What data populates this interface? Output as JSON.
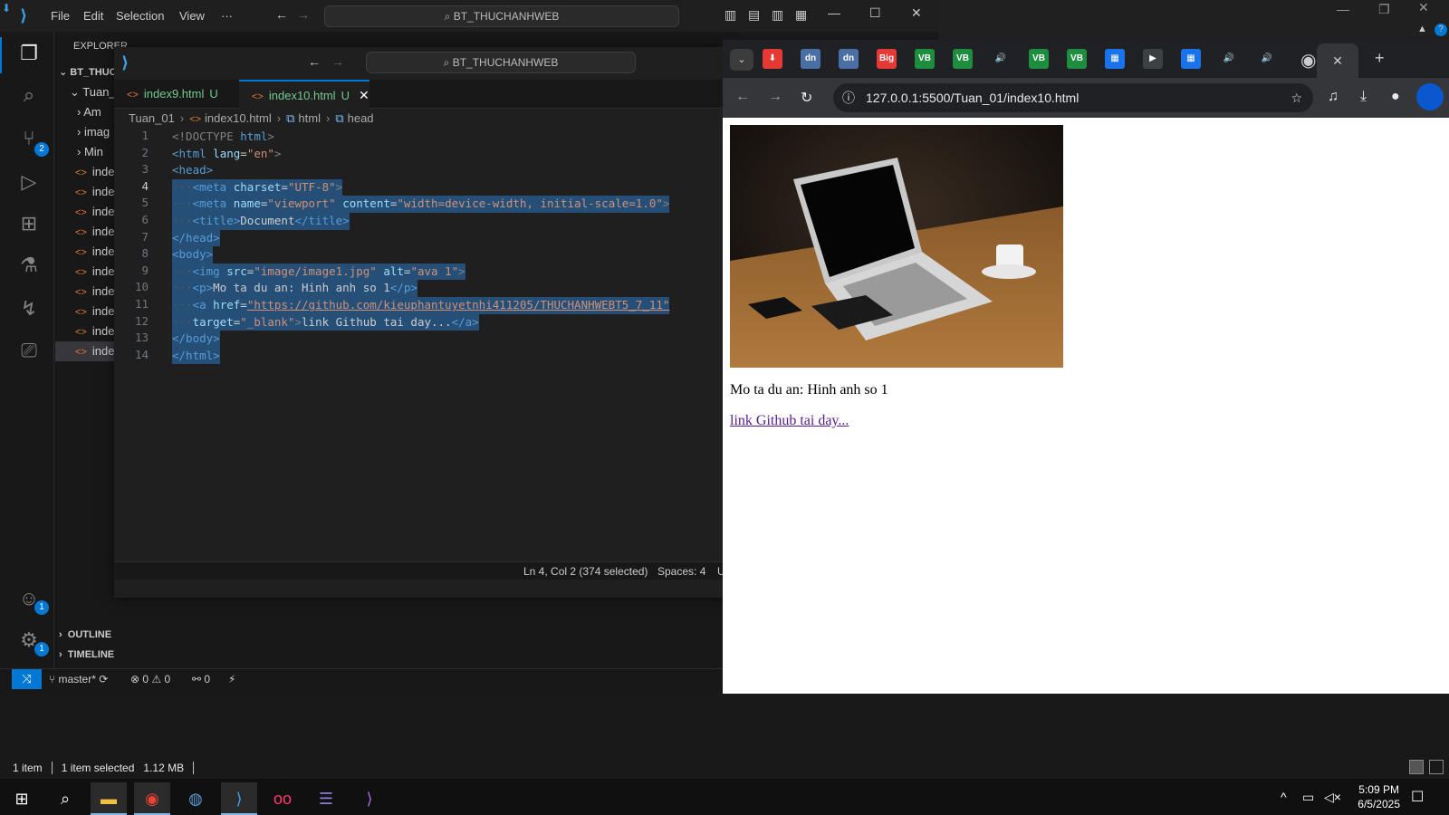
{
  "vscode_back": {
    "menu": [
      "File",
      "Edit",
      "Selection",
      "View",
      "···"
    ],
    "search": "BT_THUCHANHWEB",
    "explorer_title": "EXPLORER",
    "workspace": "BT_THUC",
    "folder": "Tuan_",
    "tree": [
      {
        "label": "Am",
        "type": "folder"
      },
      {
        "label": "imag",
        "type": "folder"
      },
      {
        "label": "Min",
        "type": "folder"
      },
      {
        "label": "inde",
        "type": "file"
      },
      {
        "label": "inde",
        "type": "file"
      },
      {
        "label": "inde",
        "type": "file"
      },
      {
        "label": "inde",
        "type": "file"
      },
      {
        "label": "inde",
        "type": "file"
      },
      {
        "label": "inde",
        "type": "file"
      },
      {
        "label": "inde",
        "type": "file"
      },
      {
        "label": "inde",
        "type": "file"
      },
      {
        "label": "inde",
        "type": "file"
      },
      {
        "label": "inde",
        "type": "file"
      }
    ],
    "outline": "OUTLINE",
    "timeline": "TIMELINE",
    "scm_badge": "2",
    "accounts_badge": "1",
    "settings_badge": "1",
    "status": {
      "branch": "master*",
      "problems": "0",
      "warnings": "0",
      "ports": "0"
    }
  },
  "vscode_front": {
    "search": "BT_THUCHANHWEB",
    "tabs": [
      {
        "label": "index9.html",
        "status": "U"
      },
      {
        "label": "index10.html",
        "status": "U"
      }
    ],
    "breadcrumbs": [
      "Tuan_01",
      "index10.html",
      "html",
      "head"
    ],
    "status": {
      "position": "Ln 4, Col 2 (374 selected)",
      "spaces": "Spaces: 4",
      "enc": "U"
    },
    "line_numbers": [
      "1",
      "2",
      "3",
      "4",
      "5",
      "6",
      "7",
      "8",
      "9",
      "10",
      "11",
      "12",
      "13",
      "14"
    ],
    "code": {
      "l1_doctype": "<!DOCTYPE",
      "l1_html": "html",
      "l2_tag": "<html",
      "l2_attr": "lang",
      "l2_val": "\"en\"",
      "l3": "<head>",
      "l4_tag": "<meta",
      "l4_attr": "charset",
      "l4_val": "\"UTF-8\"",
      "l5_tag": "<meta",
      "l5_attr1": "name",
      "l5_val1": "\"viewport\"",
      "l5_attr2": "content",
      "l5_val2": "\"width=device-width, initial-scale=1.0\"",
      "l6_open": "<title>",
      "l6_text": "Document",
      "l6_close": "</title>",
      "l7": "</head>",
      "l8": "<body>",
      "l9_tag": "<img",
      "l9_attr1": "src",
      "l9_val1": "\"image/image1.jpg\"",
      "l9_attr2": "alt",
      "l9_val2": "\"ava 1\"",
      "l10_open": "<p>",
      "l10_text": "Mo ta du an: Hinh anh so 1",
      "l10_close": "</p>",
      "l11_tag": "<a",
      "l11_attr": "href",
      "l11_val": "\"https://github.com/kieuphantuyetnhi411205/THUCHANHWEBT5_7_11\"",
      "l12_attr": "target",
      "l12_val": "\"_blank\"",
      "l12_text": "link Github tai day...",
      "l12_close": "</a>",
      "l13": "</body>",
      "l14": "</html>"
    }
  },
  "chrome": {
    "tab_icons": [
      {
        "label": "⬇",
        "color": "#e53935"
      },
      {
        "label": "dn",
        "color": "#4a6fa5"
      },
      {
        "label": "dn",
        "color": "#4a6fa5"
      },
      {
        "label": "Big",
        "color": "#e53935"
      },
      {
        "label": "VB",
        "color": "#1e8e3e"
      },
      {
        "label": "VB",
        "color": "#1e8e3e"
      },
      {
        "label": "🔊",
        "color": "transparent"
      },
      {
        "label": "VB",
        "color": "#1e8e3e"
      },
      {
        "label": "VB",
        "color": "#1e8e3e"
      },
      {
        "label": "▦",
        "color": "#1a73e8"
      },
      {
        "label": "▶",
        "color": "#3c4043"
      },
      {
        "label": "▦",
        "color": "#1a73e8"
      },
      {
        "label": "🔊",
        "color": "transparent"
      },
      {
        "label": "🔊",
        "color": "transparent"
      }
    ],
    "url": "127.0.0.1:5500/Tuan_01/index10.html",
    "page": {
      "image_alt": "ava 1",
      "description": "Mo ta du an: Hinh anh so 1",
      "link_text": "link Github tai day..."
    }
  },
  "explorer_status": {
    "items": "1 item",
    "selected": "1 item selected",
    "size": "1.12 MB"
  },
  "taskbar": {
    "time": "5:09 PM",
    "date": "6/5/2025"
  }
}
